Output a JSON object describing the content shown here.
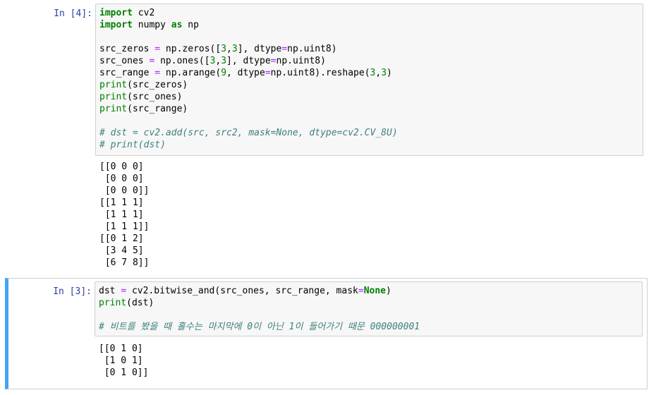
{
  "cells": [
    {
      "prompt": "In [4]:",
      "code": {
        "l1_kw": "import",
        "l1_rest": " cv2",
        "l2_kw": "import",
        "l2_mid": " numpy ",
        "l2_kw2": "as",
        "l2_rest": " np",
        "l4_a": "src_zeros ",
        "l4_eq": "=",
        "l4_b": " np.zeros([",
        "l4_n1": "3",
        "l4_c": ",",
        "l4_n2": "3",
        "l4_d": "], dtype",
        "l4_eq2": "=",
        "l4_e": "np.uint8)",
        "l5_a": "src_ones ",
        "l5_eq": "=",
        "l5_b": " np.ones([",
        "l5_n1": "3",
        "l5_c": ",",
        "l5_n2": "3",
        "l5_d": "], dtype",
        "l5_eq2": "=",
        "l5_e": "np.uint8)",
        "l6_a": "src_range ",
        "l6_eq": "=",
        "l6_b": " np.arange(",
        "l6_n1": "9",
        "l6_c": ", dtype",
        "l6_eq2": "=",
        "l6_d": "np.uint8).reshape(",
        "l6_n2": "3",
        "l6_e": ",",
        "l6_n3": "3",
        "l6_f": ")",
        "l7_fn": "print",
        "l7_rest": "(src_zeros)",
        "l8_fn": "print",
        "l8_rest": "(src_ones)",
        "l9_fn": "print",
        "l9_rest": "(src_range)",
        "l11_cm": "# dst = cv2.add(src, src2, mask=None, dtype=cv2.CV_8U)",
        "l12_cm": "# print(dst)"
      },
      "output": [
        "[[0 0 0]",
        " [0 0 0]",
        " [0 0 0]]",
        "[[1 1 1]",
        " [1 1 1]",
        " [1 1 1]]",
        "[[0 1 2]",
        " [3 4 5]",
        " [6 7 8]]"
      ]
    },
    {
      "prompt": "In [3]:",
      "code": {
        "l1_a": "dst ",
        "l1_eq": "=",
        "l1_b": " cv2.bitwise_and(src_ones, src_range, mask",
        "l1_eq2": "=",
        "l1_none": "None",
        "l1_c": ")",
        "l2_fn": "print",
        "l2_rest": "(dst)",
        "l4_cm": "# 비트를 봤을 때 홀수는 마지막에 0이 아닌 1이 들어가기 때문 000000001"
      },
      "output": [
        "[[0 1 0]",
        " [1 0 1]",
        " [0 1 0]]"
      ]
    }
  ],
  "colors": {
    "selected_border": "#42a5f5",
    "prompt": "#303f9f",
    "input_bg": "#f7f7f7"
  }
}
